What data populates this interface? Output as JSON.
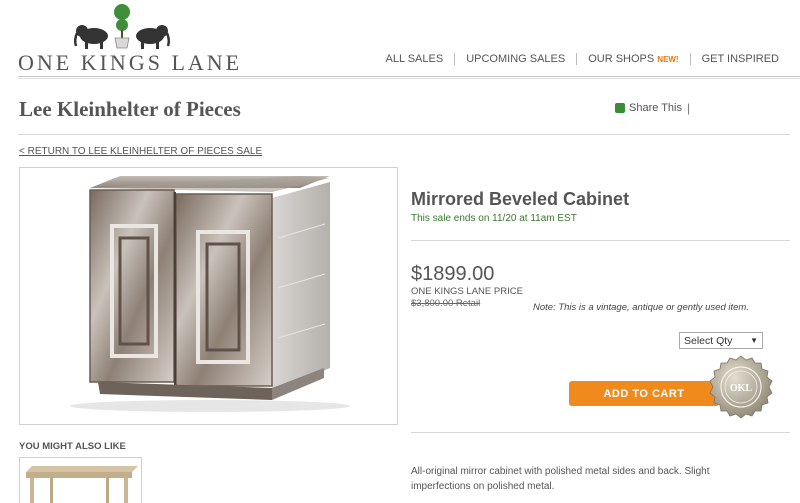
{
  "brand": {
    "name": "ONE KINGS LANE"
  },
  "nav": {
    "items": [
      {
        "label": "ALL SALES"
      },
      {
        "label": "UPCOMING SALES"
      },
      {
        "label": "OUR SHOPS",
        "badge": "NEW!"
      },
      {
        "label": "GET INSPIRED"
      }
    ]
  },
  "sale": {
    "title": "Lee Kleinhelter of Pieces",
    "share_label": "Share This",
    "share_separator": "|",
    "return_link": "< RETURN TO LEE KLEINHELTER OF PIECES SALE"
  },
  "product": {
    "name": "Mirrored Beveled Cabinet",
    "sale_ends": "This sale ends on 11/20 at 11am EST",
    "price": "$1899.00",
    "price_label": "ONE KINGS LANE PRICE",
    "retail": "$3,800.00 Retail",
    "note": "Note: This is a vintage, antique or gently used item.",
    "qty_select": "Select Qty",
    "add_to_cart": "ADD TO CART",
    "seal_text": "OKL",
    "description": "All-original mirror cabinet with polished metal sides and back. Slight imperfections on polished metal."
  },
  "recommendations": {
    "title": "YOU MIGHT ALSO LIKE"
  },
  "colors": {
    "accent": "#f08a1c",
    "new_badge": "#e8780c",
    "sale_ends": "#3a7a2e",
    "logo_tree": "#3e8e3a"
  }
}
